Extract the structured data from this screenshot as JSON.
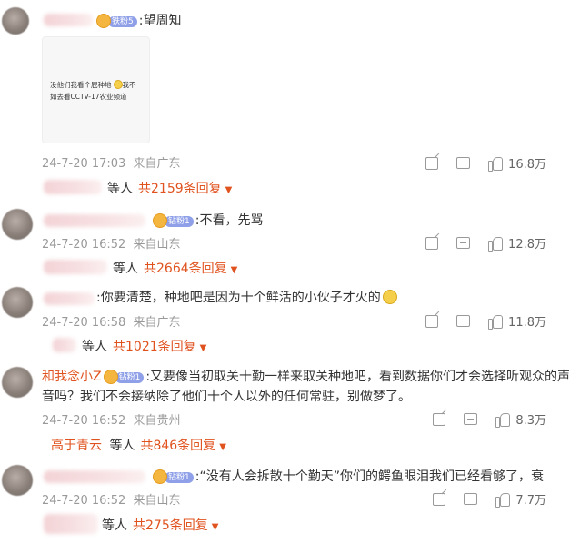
{
  "comments": [
    {
      "username": "",
      "badge_level": "铁粉5",
      "text": ":望周知",
      "image_text_line1": "没他们我看个屁种地",
      "image_text_line1b": "我不",
      "image_text_line2": "如去看CCTV-17农业频道",
      "time": "24-7-20 17:03",
      "location": "来自广东",
      "likes": "16.8万",
      "reply_by_suffix": "等人",
      "reply_total": "共2159条回复",
      "reply_arrow": "▼"
    },
    {
      "username": "",
      "badge_level": "钻粉1",
      "text": ":不看，先骂",
      "time": "24-7-20 16:52",
      "location": "来自山东",
      "likes": "12.8万",
      "reply_by_suffix": "等人",
      "reply_total": "共2664条回复",
      "reply_arrow": "▼"
    },
    {
      "username": "",
      "text": ":你要清楚，种地吧是因为十个鲜活的小伙子才火的",
      "time": "24-7-20 16:58",
      "location": "来自广东",
      "likes": "11.8万",
      "reply_by_suffix": "等人",
      "reply_total": "共1021条回复",
      "reply_arrow": "▼"
    },
    {
      "username": "和我念小Z",
      "badge_level": "钻粉1",
      "text_line1": ":又要像当初取关十勤一样来取关种地吧，看到数据你们才会选择听观众的声",
      "text_line2": "音吗？我们不会接纳除了他们十个人以外的任何常驻，别做梦了。",
      "time": "24-7-20 16:52",
      "location": "来自贵州",
      "likes": "8.3万",
      "reply_name": "高于青云",
      "reply_by_suffix": "等人",
      "reply_total": "共846条回复",
      "reply_arrow": "▼"
    },
    {
      "username": "",
      "badge_level": "钻粉1",
      "text": ":“没有人会拆散十个勤天”你们的鳄鱼眼泪我们已经看够了，衰",
      "time": "24-7-20 16:52",
      "location": "来自山东",
      "likes": "7.7万",
      "reply_by_suffix": "等人",
      "reply_total": "共275条回复",
      "reply_arrow": "▼"
    }
  ]
}
